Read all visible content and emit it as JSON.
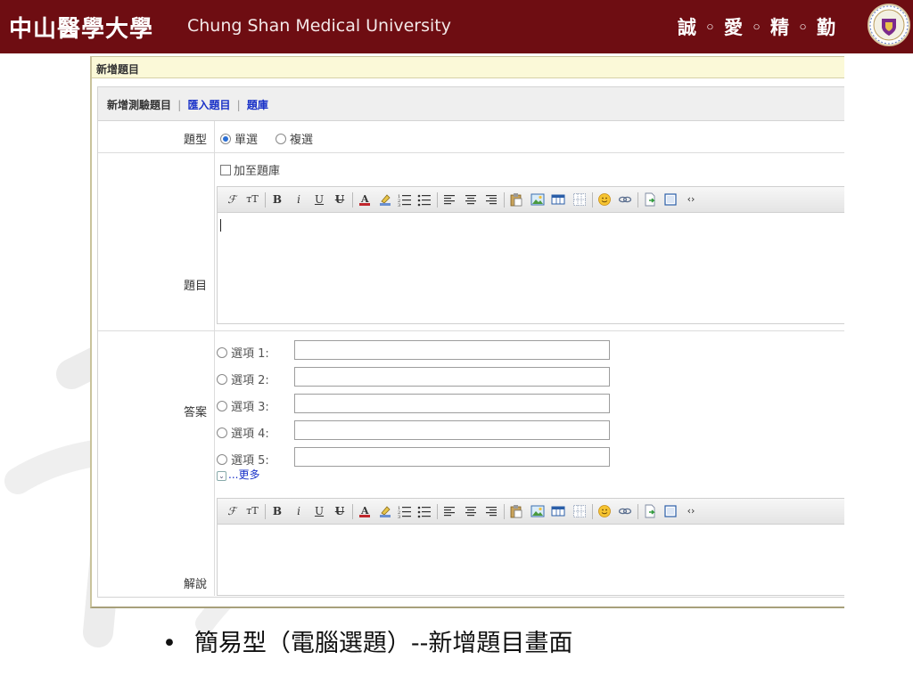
{
  "header": {
    "name_zh": "中山醫學大學",
    "name_en": "Chung Shan Medical University",
    "motto": "誠 ◦ 愛 ◦ 精 ◦ 勤",
    "colors": {
      "band": "#6e0d12",
      "accent_link": "#1a32c8",
      "frame_title_bg": "#fbf9d8"
    }
  },
  "form": {
    "title": "新增題目",
    "tabs": [
      {
        "label": "新增測驗題目",
        "active": true
      },
      {
        "label": "匯入題目",
        "active": false
      },
      {
        "label": "題庫",
        "active": false
      }
    ],
    "tab_separator": "|",
    "type_row": {
      "label": "題型",
      "options": [
        {
          "label": "單選",
          "selected": true
        },
        {
          "label": "複選",
          "selected": false
        }
      ]
    },
    "question_row": {
      "label": "題目",
      "add_to_bank_label": "加至題庫",
      "add_to_bank_checked": false,
      "editor_content": ""
    },
    "answer_row": {
      "label": "答案",
      "options": [
        {
          "label": "選項 1:",
          "value": ""
        },
        {
          "label": "選項 2:",
          "value": ""
        },
        {
          "label": "選項 3:",
          "value": ""
        },
        {
          "label": "選項 4:",
          "value": ""
        },
        {
          "label": "選項 5:",
          "value": ""
        }
      ],
      "more_label": "...更多"
    },
    "explanation_row": {
      "label": "解說",
      "editor_content": ""
    },
    "toolbar_icons": [
      "font-family-icon",
      "font-size-icon",
      "bold-icon",
      "italic-icon",
      "underline-icon",
      "strikethrough-icon",
      "font-color-icon",
      "highlight-icon",
      "ordered-list-icon",
      "unordered-list-icon",
      "align-left-icon",
      "align-center-icon",
      "align-right-icon",
      "paste-icon",
      "image-icon",
      "table-icon",
      "table-grid-icon",
      "emoticon-icon",
      "link-icon",
      "insert-file-icon",
      "fullscreen-icon",
      "source-code-icon"
    ]
  },
  "caption": {
    "bullet": "•",
    "text": "簡易型（電腦選題）--新增題目畫面"
  }
}
